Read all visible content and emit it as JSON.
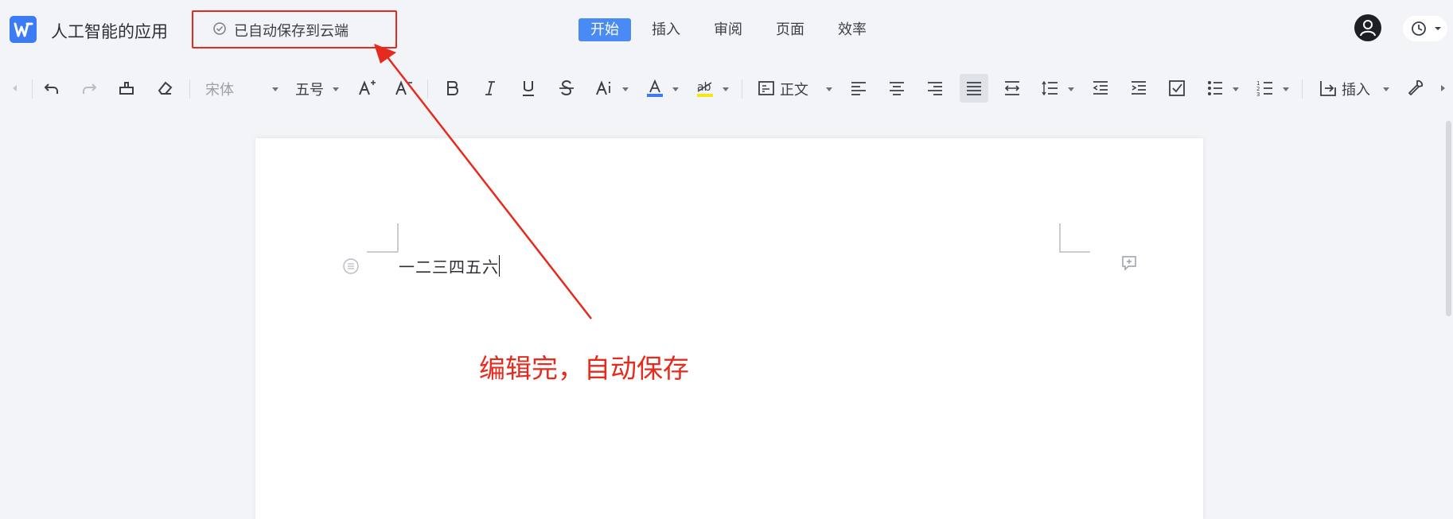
{
  "app": {
    "logo_letter": "W",
    "doc_title": "人工智能的应用",
    "save_status": "已自动保存到云端",
    "tabs": [
      "开始",
      "插入",
      "审阅",
      "页面",
      "效率"
    ],
    "active_tab": "开始"
  },
  "toolbar": {
    "font_family": "宋体",
    "font_size": "五号",
    "paragraph_style": "正文",
    "insert_label": "插入",
    "font_color": "#3b7cf5",
    "highlight_color": "#f5e615"
  },
  "document": {
    "body_text": "一二三四五六"
  },
  "annotation": {
    "text": "编辑完，自动保存",
    "color": "#e52a1e"
  }
}
